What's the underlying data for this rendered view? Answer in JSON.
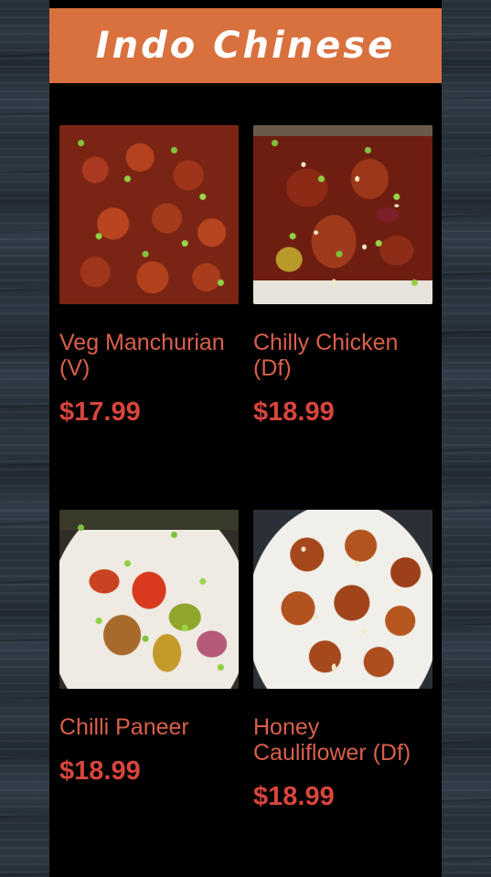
{
  "header": {
    "title": "Indo Chinese"
  },
  "menu": {
    "items": [
      {
        "name": "Veg Manchurian (V)",
        "price": "$17.99",
        "image": "veg-manchurian-photo"
      },
      {
        "name": "Chilly Chicken (Df)",
        "price": "$18.99",
        "image": "chilly-chicken-photo"
      },
      {
        "name": "Chilli Paneer",
        "price": "$18.99",
        "image": "chilli-paneer-photo"
      },
      {
        "name": "Honey Cauliflower (Df)",
        "price": "$18.99",
        "image": "honey-cauliflower-photo"
      }
    ]
  },
  "colors": {
    "header_bg": "#d9713f",
    "name_text": "#d9604a",
    "price_text": "#d8453d",
    "panel_bg": "#000000"
  }
}
